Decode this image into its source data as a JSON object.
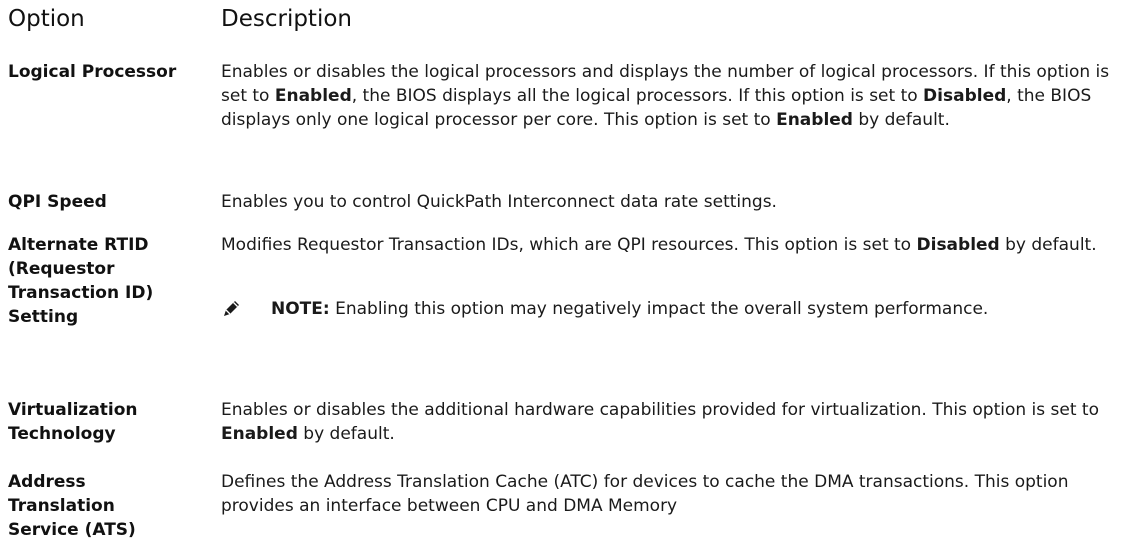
{
  "header": {
    "option": "Option",
    "description": "Description"
  },
  "rows": [
    {
      "name": "Logical Processor",
      "parts": [
        "Enables or disables the logical processors and displays the number of logical processors. If this option is set to ",
        "Enabled",
        ", the BIOS displays all the logical processors. If this option is set to ",
        "Disabled",
        ", the BIOS displays only one logical processor per core. This option is set to ",
        "Enabled",
        " by default."
      ]
    },
    {
      "name": "QPI Speed",
      "parts": [
        "Enables you to control QuickPath Interconnect data rate settings."
      ]
    },
    {
      "name": "Alternate RTID (Requestor Transaction ID) Setting",
      "parts": [
        "Modifies Requestor Transaction IDs, which are QPI resources. This option is set to ",
        "Disabled",
        " by default."
      ],
      "note_label": "NOTE:",
      "note_text": " Enabling this option may negatively impact the overall system performance."
    },
    {
      "name": "Virtualization Technology",
      "parts": [
        "Enables or disables the additional hardware capabilities provided for virtualization. This option is set to ",
        "Enabled",
        " by default."
      ]
    },
    {
      "name": "Address Translation Service (ATS)",
      "parts": [
        "Defines the Address Translation Cache (ATC) for devices to cache the DMA transactions. This option provides an interface between CPU and DMA Memory"
      ]
    }
  ]
}
